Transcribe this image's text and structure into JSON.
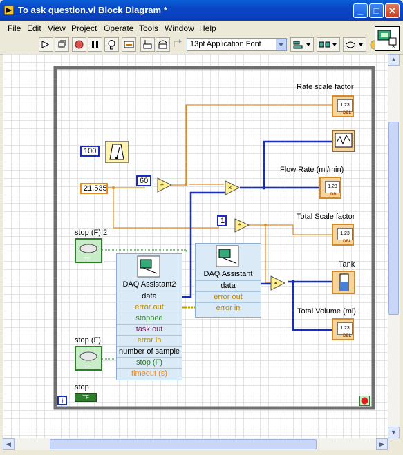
{
  "window": {
    "title": "To ask question.vi Block Diagram *",
    "min": "_",
    "max": "□",
    "close": "✕"
  },
  "menu": [
    "File",
    "Edit",
    "View",
    "Project",
    "Operate",
    "Tools",
    "Window",
    "Help"
  ],
  "toolbar": {
    "font": "13pt Application Font"
  },
  "diagram": {
    "rate_scale_factor": "Rate scale factor",
    "flow_rate": "Flow Rate (ml/min)",
    "total_scale_factor": "Total Scale factor",
    "tank": "Tank",
    "total_volume": "Total Volume (ml)",
    "stop_f2": "stop (F) 2",
    "stop_f": "stop (F)",
    "stop": "stop",
    "const_100": "100",
    "const_60": "60",
    "const_21535": "21.535",
    "const_1": "1",
    "ind_value": "1.23",
    "ind_type": "DBL",
    "tf": "TF",
    "loop_i": "i",
    "daq2": {
      "title": "DAQ Assistant2",
      "rows": [
        "data",
        "error out",
        "stopped",
        "task out",
        "error in",
        "number of sample",
        "stop (F)",
        "timeout (s)"
      ]
    },
    "daq1": {
      "title": "DAQ Assistant",
      "rows": [
        "data",
        "error out",
        "error in"
      ]
    }
  },
  "colors": {
    "orange_wire": "#e78a1d",
    "blue_wire": "#1a2cc6",
    "green": "#2e7e2e",
    "loop_border": "#6e6e6e"
  }
}
